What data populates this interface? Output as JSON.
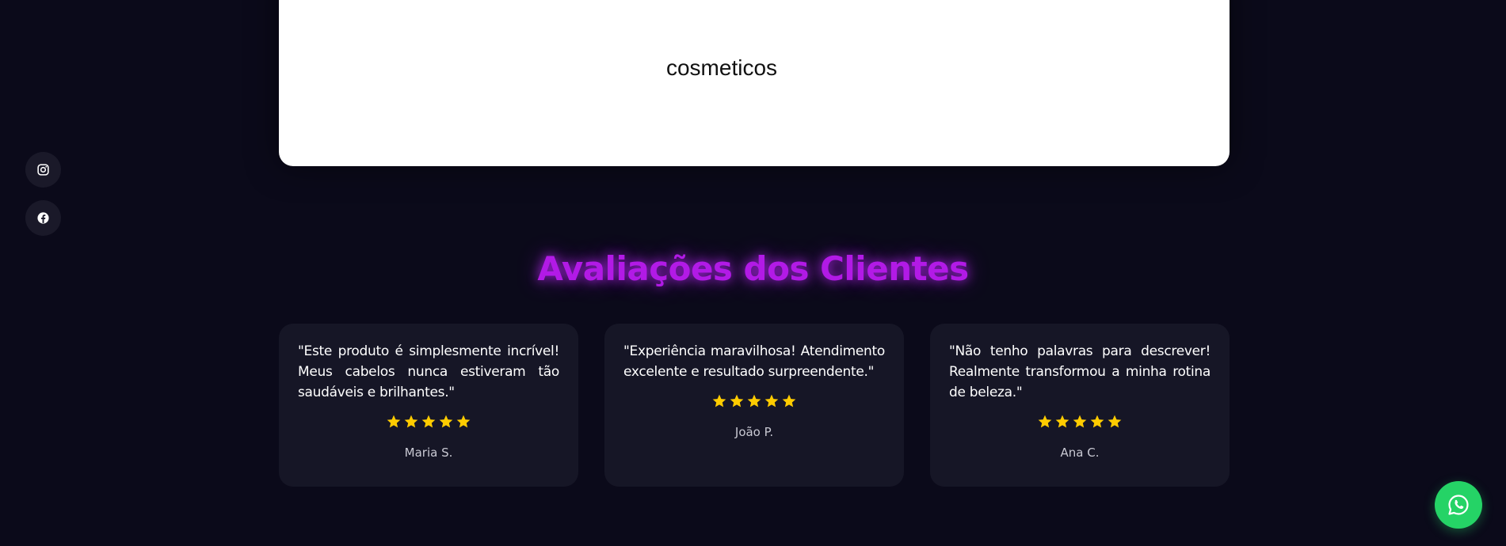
{
  "hero": {
    "subtitle": "cosmeticos"
  },
  "social": [
    {
      "icon": "instagram-icon"
    },
    {
      "icon": "facebook-icon"
    }
  ],
  "reviews": {
    "title": "Avaliações dos Clientes",
    "items": [
      {
        "quote": "\"Este produto é simplesmente incrível! Meus cabelos nunca estiveram tão saudáveis e brilhantes.\"",
        "rating": 5,
        "author": "Maria S."
      },
      {
        "quote": "\"Experiência maravilhosa! Atendimento excelente e resultado surpreendente.\"",
        "rating": 5,
        "author": "João P."
      },
      {
        "quote": "\"Não tenho palavras para descrever! Realmente transformou a minha rotina de beleza.\"",
        "rating": 5,
        "author": "Ana C."
      }
    ]
  },
  "colors": {
    "background": "#0b0a1a",
    "card": "#161626",
    "title": "#b21ae6",
    "star": "#ffcc00",
    "whatsapp": "#25d366"
  },
  "floating_button": {
    "icon": "whatsapp-icon"
  }
}
